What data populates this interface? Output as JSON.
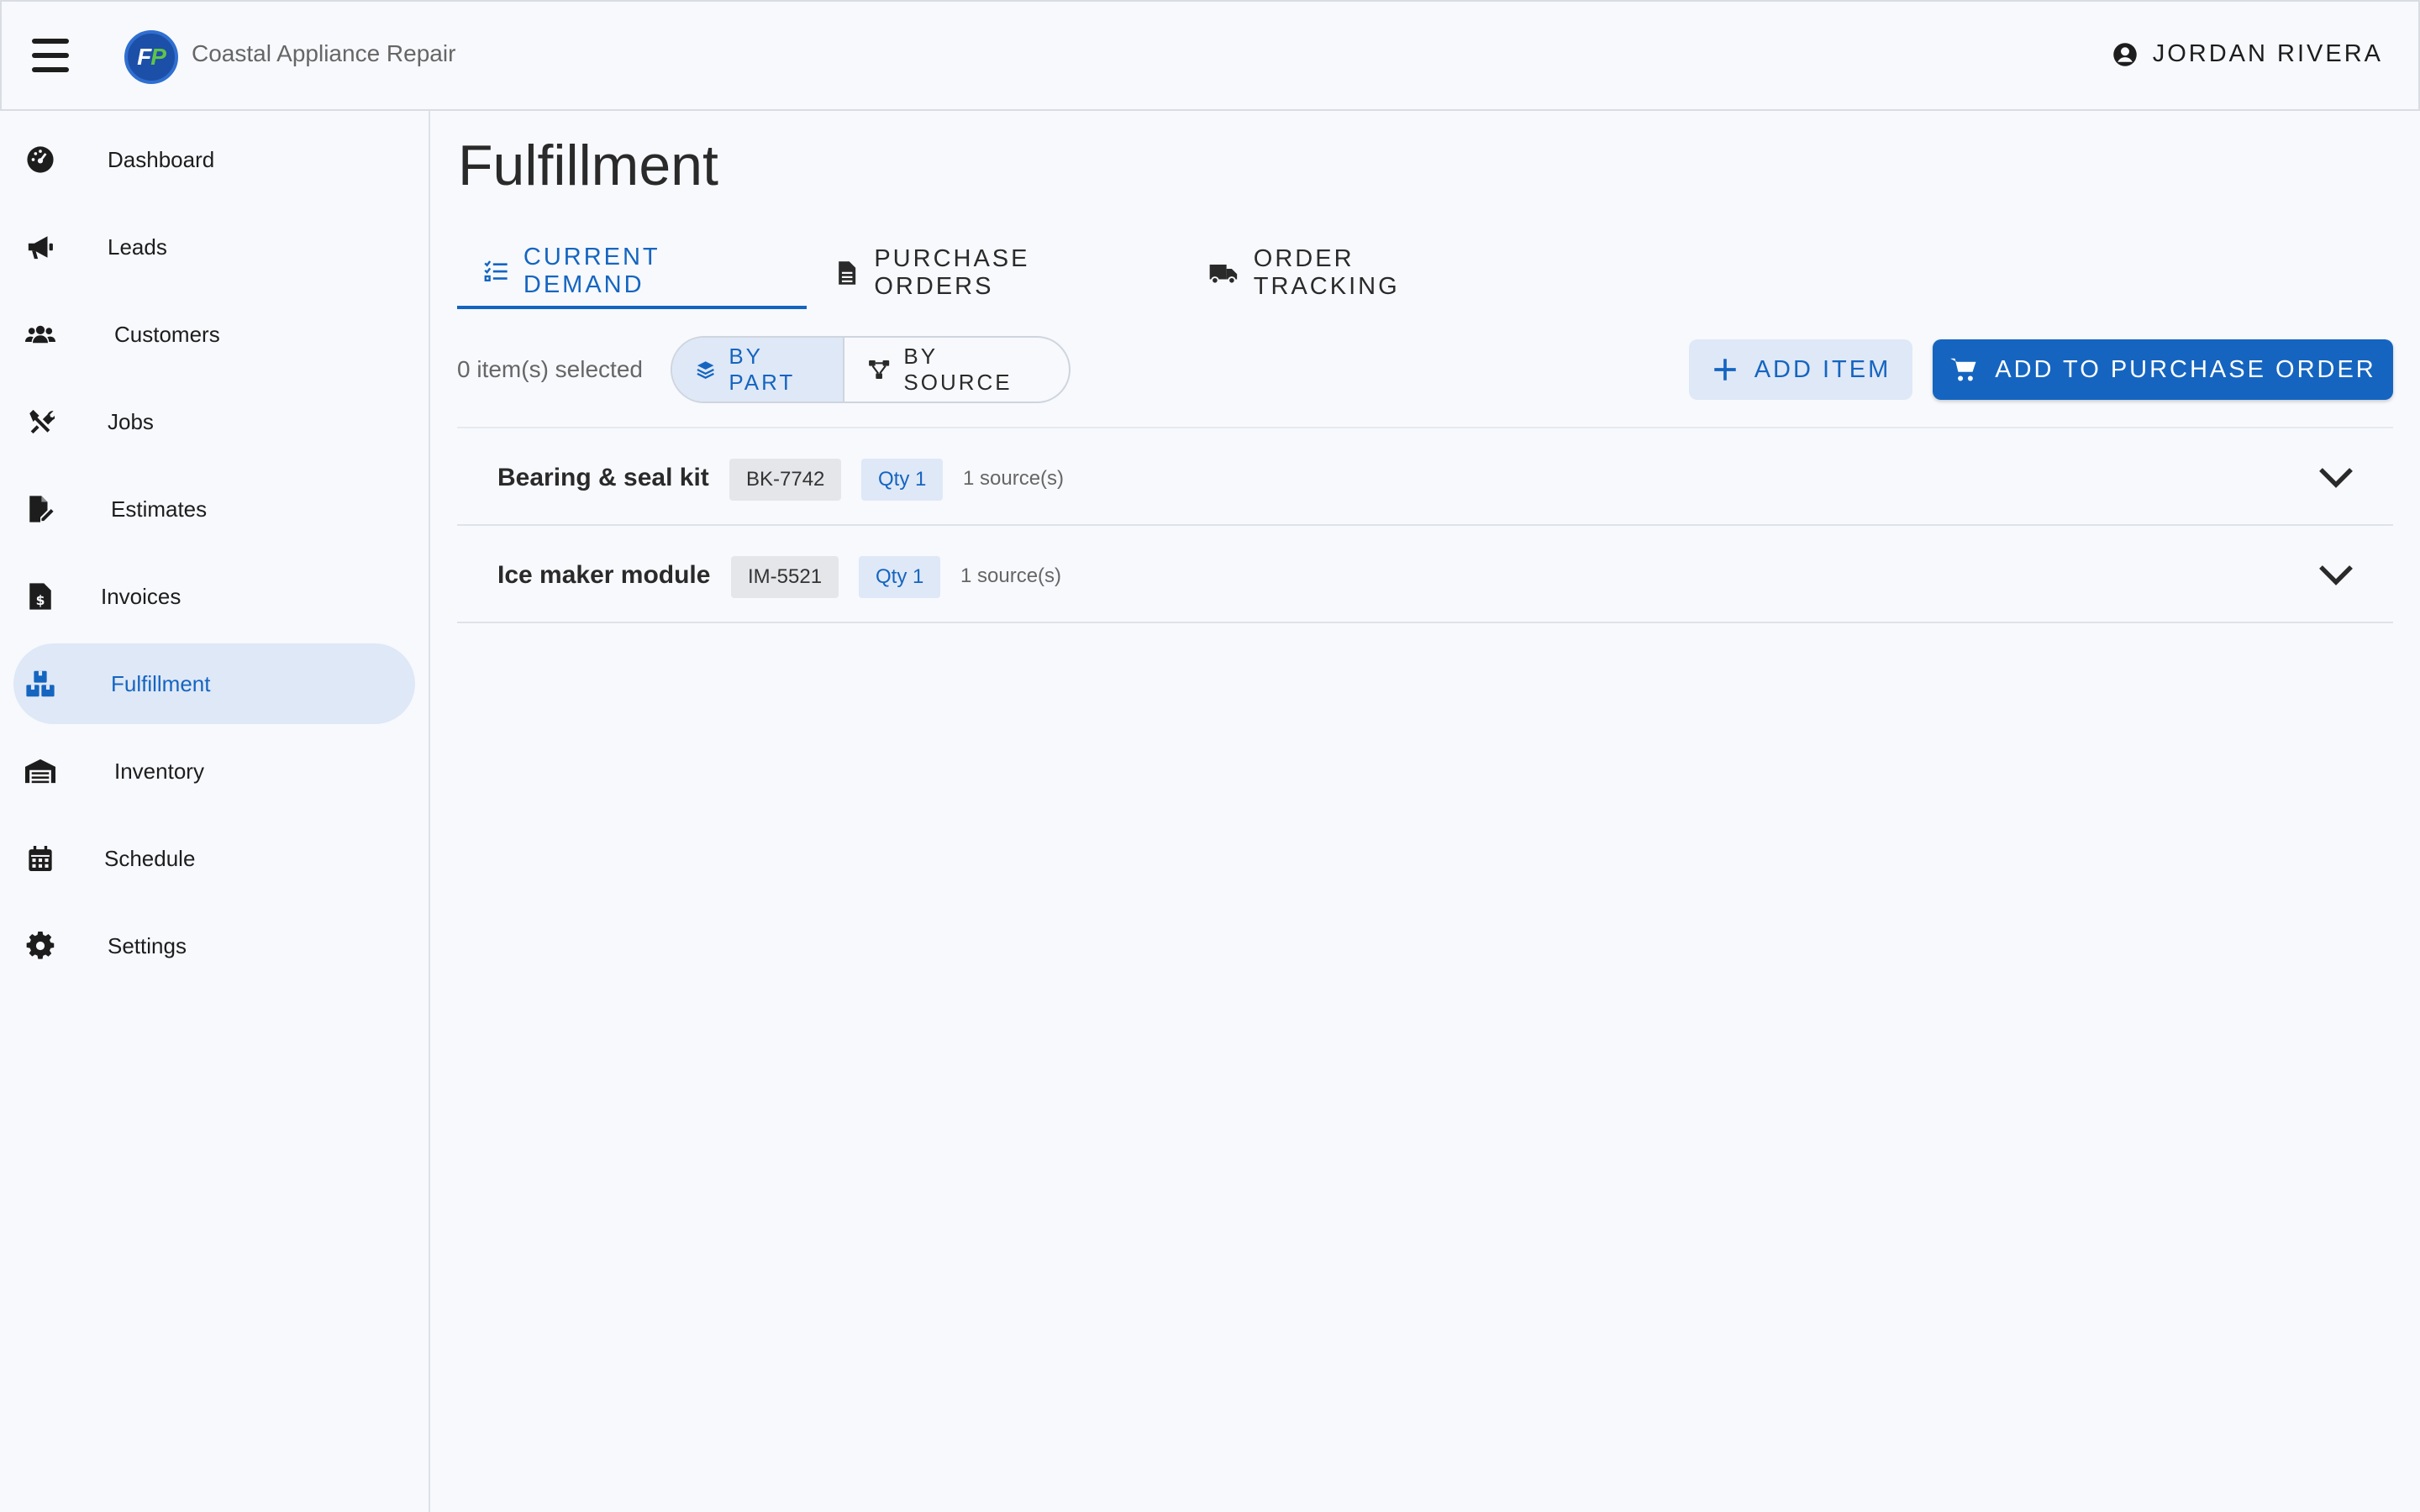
{
  "header": {
    "company": "Coastal Appliance Repair",
    "user": "JORDAN RIVERA"
  },
  "sidebar": {
    "items": [
      {
        "label": "Dashboard",
        "icon": "dashboard-gauge-icon"
      },
      {
        "label": "Leads",
        "icon": "megaphone-icon"
      },
      {
        "label": "Customers",
        "icon": "users-icon"
      },
      {
        "label": "Jobs",
        "icon": "tools-icon"
      },
      {
        "label": "Estimates",
        "icon": "file-edit-icon"
      },
      {
        "label": "Invoices",
        "icon": "invoice-dollar-icon"
      },
      {
        "label": "Fulfillment",
        "icon": "boxes-icon",
        "active": true
      },
      {
        "label": "Inventory",
        "icon": "warehouse-icon"
      },
      {
        "label": "Schedule",
        "icon": "calendar-icon"
      },
      {
        "label": "Settings",
        "icon": "gear-icon"
      }
    ]
  },
  "main": {
    "title": "Fulfillment",
    "tabs": [
      {
        "label": "CURRENT DEMAND",
        "active": true
      },
      {
        "label": "PURCHASE ORDERS"
      },
      {
        "label": "ORDER TRACKING"
      }
    ],
    "toolbar": {
      "selected_text": "0 item(s) selected",
      "by_part": "BY PART",
      "by_source": "BY SOURCE",
      "add_item": "ADD ITEM",
      "add_to_po": "ADD TO PURCHASE ORDER"
    },
    "items": [
      {
        "name": "Bearing & seal kit",
        "part": "BK-7742",
        "qty": "Qty 1",
        "sources": "1 source(s)"
      },
      {
        "name": "Ice maker module",
        "part": "IM-5521",
        "qty": "Qty 1",
        "sources": "1 source(s)"
      }
    ]
  },
  "colors": {
    "accent": "#1565c0",
    "accent_soft": "#dfe8f7",
    "background": "#f7f9fd"
  }
}
